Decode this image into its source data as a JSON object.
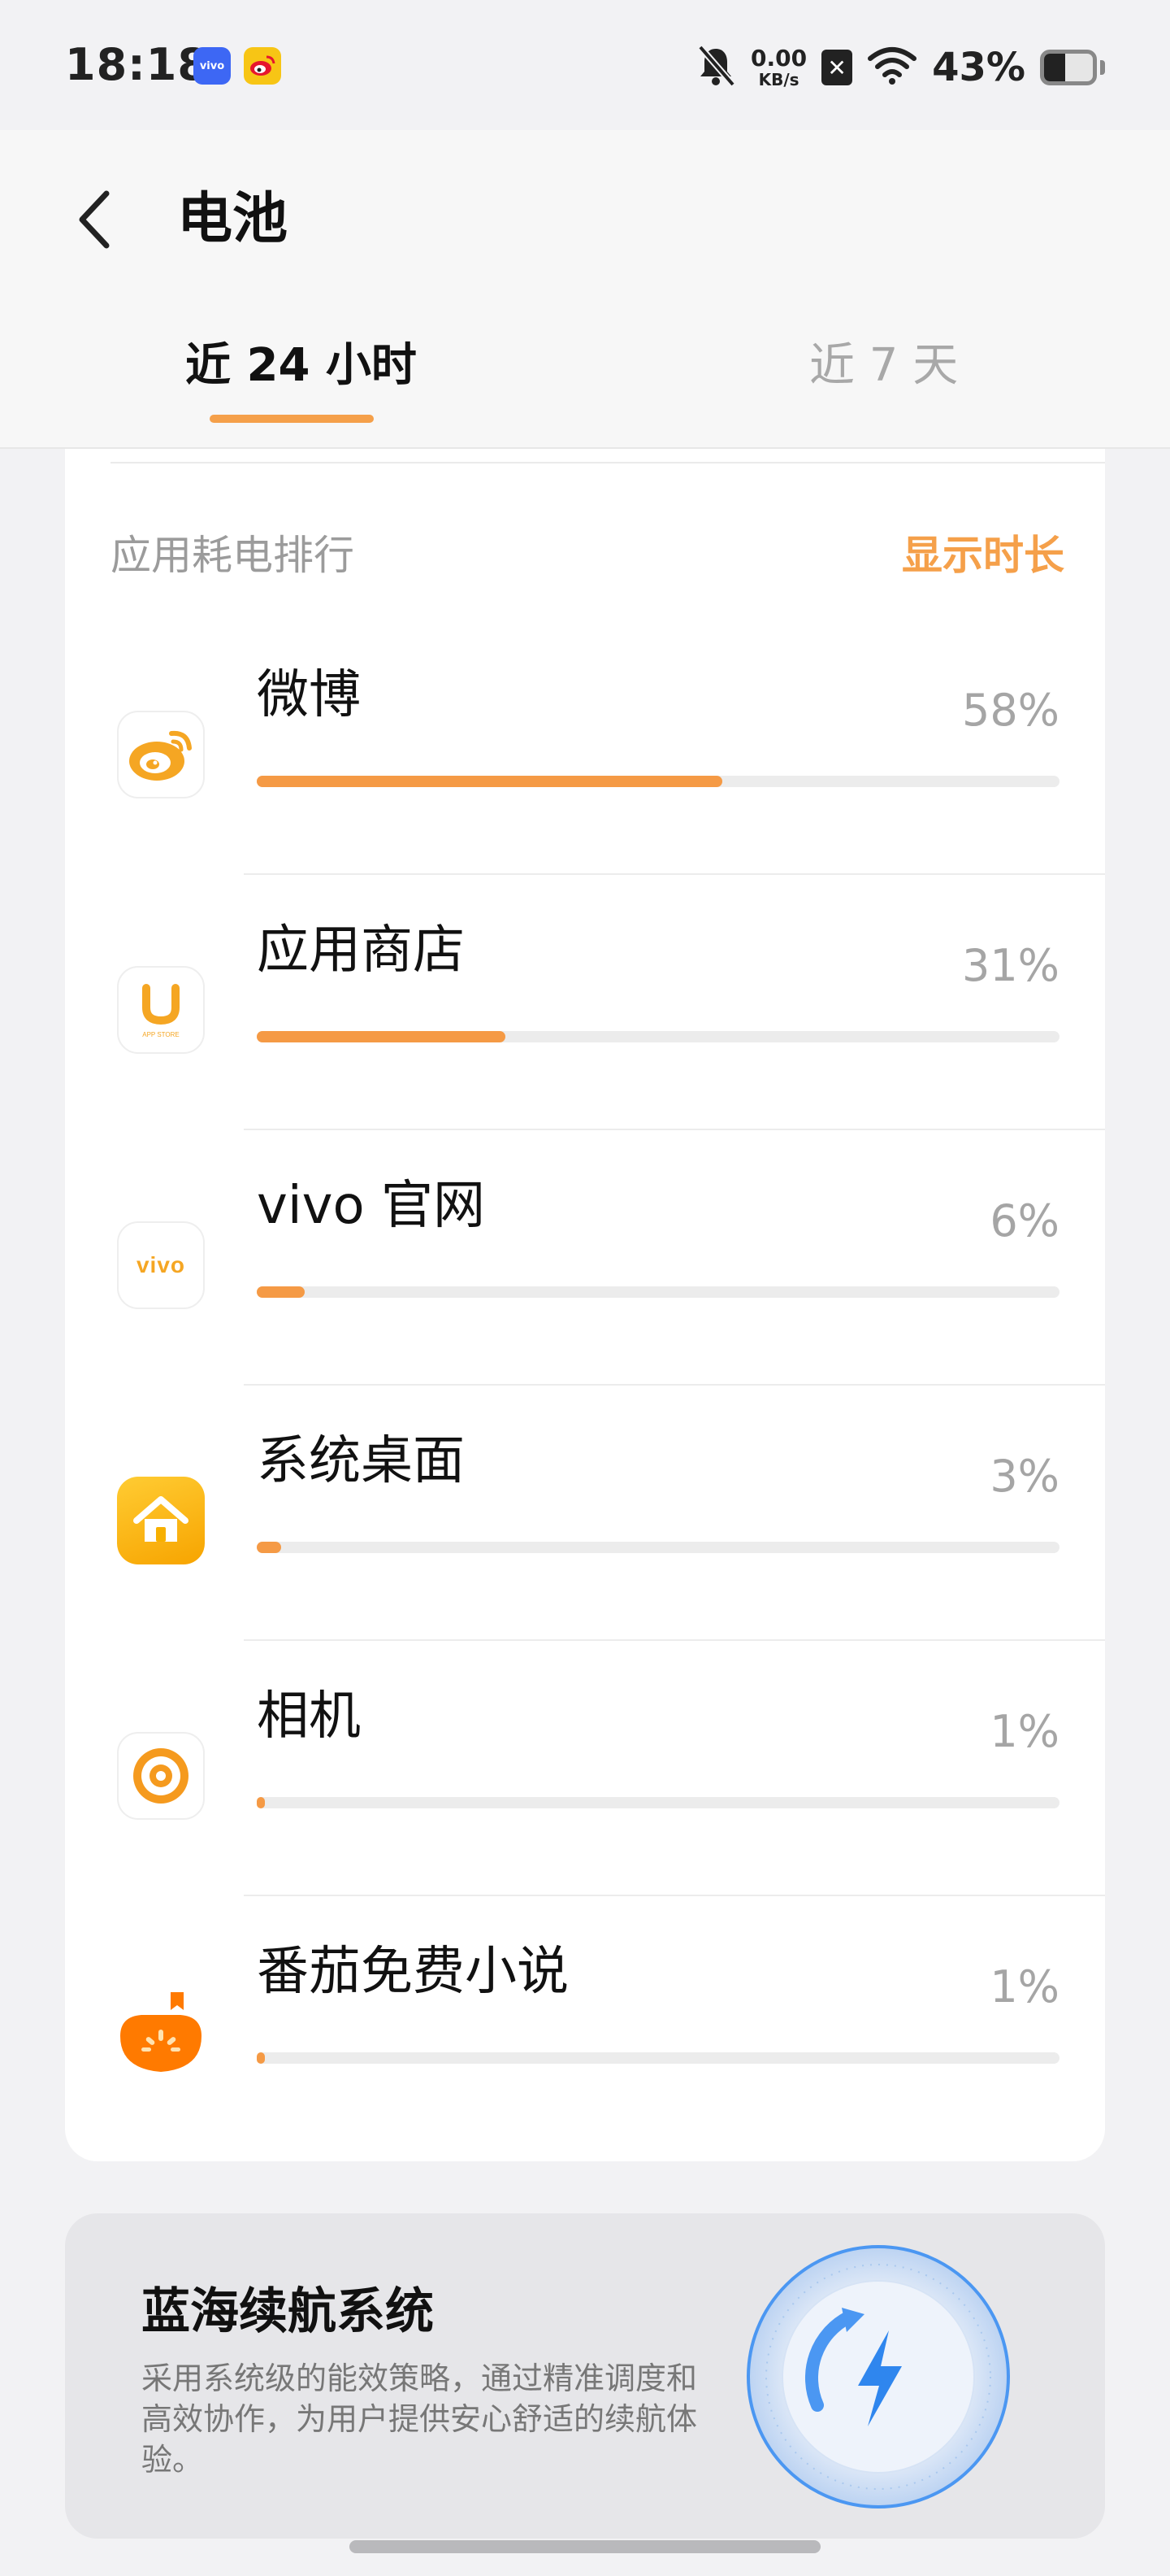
{
  "status_bar": {
    "time": "18:18",
    "notif_app1_label": "vivo",
    "net_speed_value": "0.00",
    "net_speed_unit": "KB/s",
    "battery_text": "43%",
    "battery_level": 0.43
  },
  "header": {
    "title": "电池",
    "tabs": [
      {
        "label": "近 24 小时",
        "active": true
      },
      {
        "label": "近 7 天",
        "active": false
      }
    ]
  },
  "ranking": {
    "title": "应用耗电排行",
    "action_label": "显示时长",
    "apps": [
      {
        "name": "微博",
        "percent_text": "58%",
        "bar_fraction": 0.58,
        "icon": "weibo-icon"
      },
      {
        "name": "应用商店",
        "percent_text": "31%",
        "bar_fraction": 0.31,
        "icon": "app-store-icon",
        "icon_text": "APP STORE"
      },
      {
        "name": "vivo 官网",
        "percent_text": "6%",
        "bar_fraction": 0.06,
        "icon": "vivo-icon",
        "icon_text": "vivo"
      },
      {
        "name": "系统桌面",
        "percent_text": "3%",
        "bar_fraction": 0.03,
        "icon": "home-icon"
      },
      {
        "name": "相机",
        "percent_text": "1%",
        "bar_fraction": 0.01,
        "icon": "camera-icon"
      },
      {
        "name": "番茄免费小说",
        "percent_text": "1%",
        "bar_fraction": 0.01,
        "icon": "tomato-novel-icon"
      }
    ]
  },
  "promo": {
    "title": "蓝海续航系统",
    "description": "采用系统级的能效策略，通过精准调度和高效协作，为用户提供安心舒适的续航体验。"
  },
  "colors": {
    "accent_orange": "#f5a04a",
    "bar_orange": "#f59a45",
    "promo_blue": "#3a8df0"
  }
}
